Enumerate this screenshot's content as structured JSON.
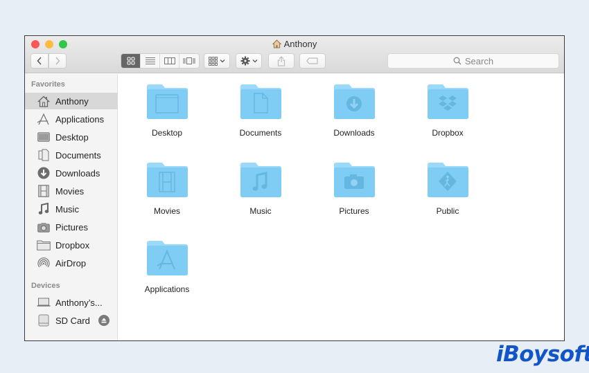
{
  "window": {
    "title": "Anthony",
    "title_icon": "home-icon"
  },
  "toolbar": {
    "back_icon": "chevron-left-icon",
    "forward_icon": "chevron-right-icon",
    "view_modes": [
      {
        "name": "icon-view",
        "active": true
      },
      {
        "name": "list-view",
        "active": false
      },
      {
        "name": "column-view",
        "active": false
      },
      {
        "name": "cover-flow-view",
        "active": false
      }
    ],
    "arrange_icon": "arrange-grid-icon",
    "action_icon": "gear-icon",
    "share_icon": "share-icon",
    "tag_icon": "tag-icon",
    "search_placeholder": "Search"
  },
  "sidebar": {
    "favorites_header": "Favorites",
    "favorites": [
      {
        "label": "Anthony",
        "icon": "home-icon",
        "selected": true
      },
      {
        "label": "Applications",
        "icon": "applications-icon"
      },
      {
        "label": "Desktop",
        "icon": "desktop-icon"
      },
      {
        "label": "Documents",
        "icon": "documents-icon"
      },
      {
        "label": "Downloads",
        "icon": "downloads-icon"
      },
      {
        "label": "Movies",
        "icon": "movies-icon"
      },
      {
        "label": "Music",
        "icon": "music-icon"
      },
      {
        "label": "Pictures",
        "icon": "pictures-icon"
      },
      {
        "label": "Dropbox",
        "icon": "folder-icon"
      },
      {
        "label": "AirDrop",
        "icon": "airdrop-icon"
      }
    ],
    "devices_header": "Devices",
    "devices": [
      {
        "label": "Anthony’s...",
        "icon": "laptop-icon"
      },
      {
        "label": "SD Card",
        "icon": "drive-icon",
        "eject": true,
        "highlighted": true
      }
    ]
  },
  "files": [
    {
      "label": "Desktop",
      "glyph": "desktop"
    },
    {
      "label": "Documents",
      "glyph": "document"
    },
    {
      "label": "Downloads",
      "glyph": "download"
    },
    {
      "label": "Dropbox",
      "glyph": "dropbox"
    },
    {
      "label": "Movies",
      "glyph": "film"
    },
    {
      "label": "Music",
      "glyph": "music"
    },
    {
      "label": "Pictures",
      "glyph": "camera"
    },
    {
      "label": "Public",
      "glyph": "public"
    },
    {
      "label": "Applications",
      "glyph": "apps"
    }
  ],
  "watermark": "iBoysoft",
  "colors": {
    "folder": "#7fcdf5",
    "folder_tab": "#9ad9f8",
    "highlight": "#e8141b",
    "brand": "#1155c9"
  }
}
